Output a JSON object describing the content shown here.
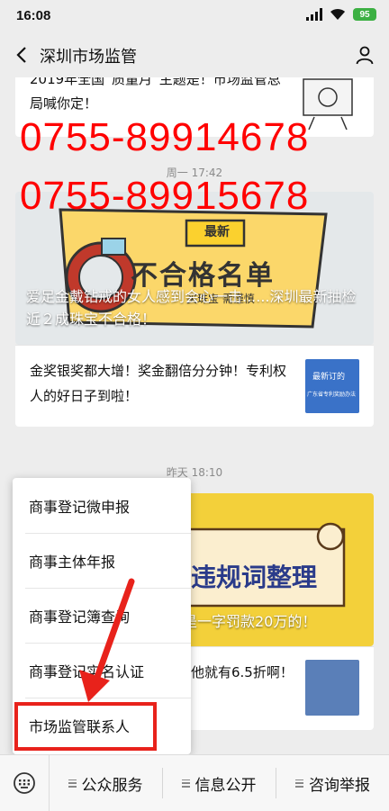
{
  "status": {
    "time": "16:08",
    "battery": "95"
  },
  "nav": {
    "title": "深圳市场监管"
  },
  "article1": {
    "text": "2019年全国“质量月”主题是！市场监管总局喊你定！"
  },
  "phones": [
    "0755-89914678",
    "0755-89915678"
  ],
  "timestamps": [
    "周一 17:42",
    "昨天 18:10"
  ],
  "article2": {
    "caption": "爱足金戴钻戒的女人感到会心一击......深圳最新抽检近２成珠宝不合格！",
    "banner_badge": "最新",
    "banner_title": "不合格名单",
    "banner_sub": "买珠宝  需谨慎"
  },
  "article3": {
    "text": "金奖银奖都大增！奖金翻倍分分钟！专利权人的好日子到啦！",
    "thumb_label": "最新订的",
    "thumb_sub": "广东省专利奖励办法"
  },
  "article4": {
    "caption": "们是一字罚款20万的！",
    "banner_title": "违规词整理"
  },
  "article5": {
    "text": "他就有6.5折啊！"
  },
  "menu": {
    "items": [
      "商事登记微申报",
      "商事主体年报",
      "商事登记簿查询",
      "商事登记实名认证",
      "市场监管联系人"
    ]
  },
  "bottom": {
    "tabs": [
      "公众服务",
      "信息公开",
      "咨询举报"
    ]
  },
  "colors": {
    "red": "#e8221b",
    "phone": "#ff0000",
    "battery": "#3cb043"
  }
}
